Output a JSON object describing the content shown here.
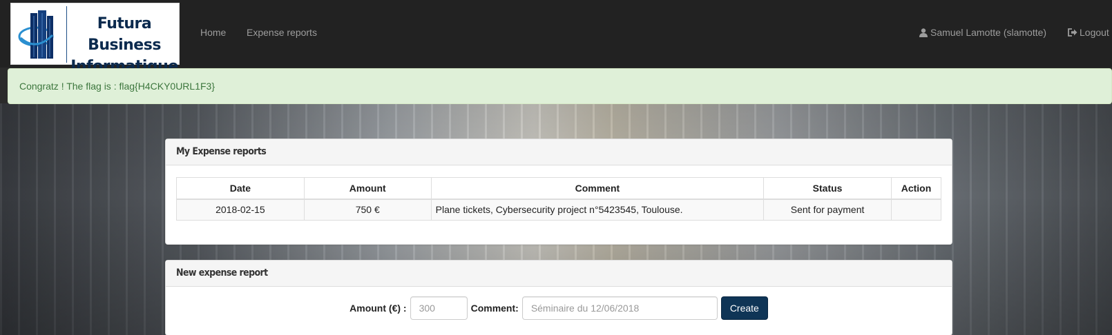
{
  "brand": {
    "line1": "Futura Business",
    "line2": "Informatique"
  },
  "nav": {
    "home": "Home",
    "expense_reports": "Expense reports",
    "user": "Samuel Lamotte (slamotte)",
    "logout": "Logout",
    "user_icon": "user-icon",
    "logout_icon": "logout-icon"
  },
  "alert": {
    "message": "Congratz ! The flag is : flag{H4CKY0URL1F3}"
  },
  "reports_panel": {
    "title": "My Expense reports",
    "columns": [
      "Date",
      "Amount",
      "Comment",
      "Status",
      "Action"
    ],
    "rows": [
      {
        "date": "2018-02-15",
        "amount": "750 €",
        "comment": "Plane tickets, Cybersecurity project n°5423545, Toulouse.",
        "status": "Sent for payment",
        "action": ""
      }
    ]
  },
  "new_panel": {
    "title": "New expense report",
    "amount_label": "Amount (€) :",
    "amount_placeholder": "300",
    "comment_label": "Comment:",
    "comment_placeholder": "Séminaire du 12/06/2018",
    "create_button": "Create"
  },
  "colors": {
    "navbar": "#222222",
    "alert_bg": "#dff0d8",
    "alert_text": "#3c763d",
    "button": "#0f3556"
  }
}
